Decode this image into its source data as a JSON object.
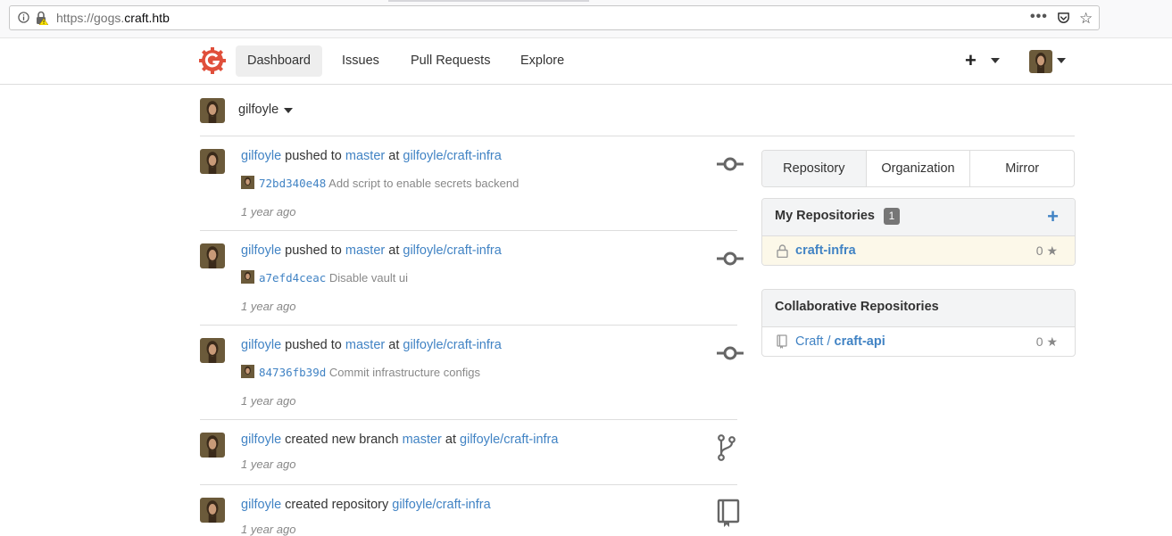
{
  "browser": {
    "url_prefix": "https://gogs.",
    "url_host": "craft.htb",
    "menu_dots": "•••"
  },
  "nav": {
    "items": [
      {
        "label": "Dashboard",
        "active": true
      },
      {
        "label": "Issues"
      },
      {
        "label": "Pull Requests"
      },
      {
        "label": "Explore"
      }
    ],
    "plus": "+"
  },
  "context": {
    "user": "gilfoyle"
  },
  "feed": [
    {
      "user": "gilfoyle",
      "action": "pushed to",
      "ref": "master",
      "at": "at",
      "repo": "gilfoyle/craft-infra",
      "commit_sha": "72bd340e48",
      "commit_msg": "Add script to enable secrets backend",
      "time": "1 year ago",
      "icon": "git-commit-icon"
    },
    {
      "user": "gilfoyle",
      "action": "pushed to",
      "ref": "master",
      "at": "at",
      "repo": "gilfoyle/craft-infra",
      "commit_sha": "a7efd4ceac",
      "commit_msg": "Disable vault ui",
      "time": "1 year ago",
      "icon": "git-commit-icon"
    },
    {
      "user": "gilfoyle",
      "action": "pushed to",
      "ref": "master",
      "at": "at",
      "repo": "gilfoyle/craft-infra",
      "commit_sha": "84736fb39d",
      "commit_msg": "Commit infrastructure configs",
      "time": "1 year ago",
      "icon": "git-commit-icon"
    },
    {
      "user": "gilfoyle",
      "action": "created new branch",
      "ref": "master",
      "at": "at",
      "repo": "gilfoyle/craft-infra",
      "time": "1 year ago",
      "icon": "git-branch-icon"
    },
    {
      "user": "gilfoyle",
      "action": "created repository",
      "repo": "gilfoyle/craft-infra",
      "time": "1 year ago",
      "icon": "repo-book-icon"
    }
  ],
  "sidebar": {
    "tabs": [
      "Repository",
      "Organization",
      "Mirror"
    ],
    "my_repos": {
      "title": "My Repositories",
      "count": "1",
      "plus": "+",
      "items": [
        {
          "name": "craft-infra",
          "stars": "0",
          "private": true
        }
      ]
    },
    "collab_repos": {
      "title": "Collaborative Repositories",
      "items": [
        {
          "owner": "Craft / ",
          "name": "craft-api",
          "stars": "0"
        }
      ]
    },
    "star_glyph": "★"
  }
}
